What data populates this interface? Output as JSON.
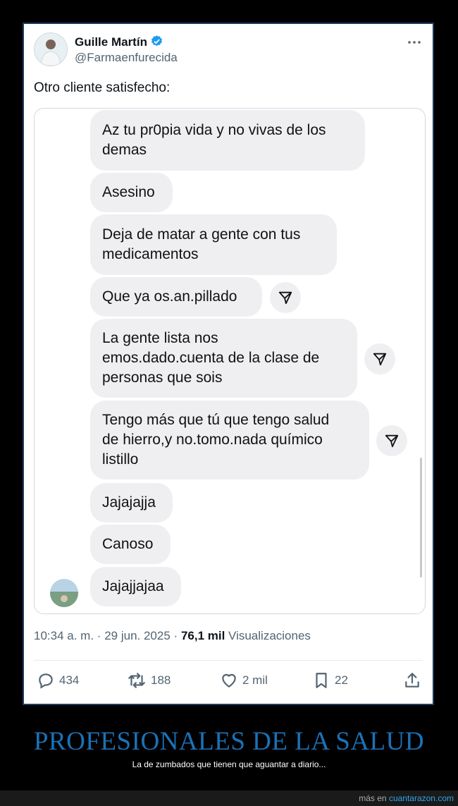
{
  "tweet": {
    "author_name": "Guille Martín",
    "handle": "@Farmaenfurecida",
    "text": "Otro cliente satisfecho:",
    "time": "10:34 a. m.",
    "separator": "·",
    "date": "29 jun. 2025",
    "views_count": "76,1 mil",
    "views_label": "Visualizaciones",
    "verified_icon": "verified-badge-icon",
    "accent_color": "#1d9bf0"
  },
  "chat": {
    "messages": [
      {
        "text": "Az tu pr0pia vida y no vivas de los\ndemas"
      },
      {
        "text": "Asesino"
      },
      {
        "text": "Deja de matar a gente con tus\nmedicamentos"
      },
      {
        "text": "Que ya os.an.pillado"
      },
      {
        "text": "La gente lista nos\nemos.dado.cuenta de la clase de\npersonas que sois"
      },
      {
        "text": "Tengo más que tú que tengo salud\nde hierro,y no.tomo.nada químico\nlistillo"
      },
      {
        "text": "Jajajajja"
      },
      {
        "text": "Canoso"
      },
      {
        "text": "Jajajjajaa"
      }
    ]
  },
  "actions": {
    "replies": "434",
    "retweets": "188",
    "likes": "2 mil",
    "bookmarks": "22"
  },
  "page": {
    "headline": "PROFESIONALES DE LA SALUD",
    "subline": "La de zumbados que tienen que aguantar a diario...",
    "footer_prefix": "más en",
    "footer_link": "cuantarazon.com"
  }
}
